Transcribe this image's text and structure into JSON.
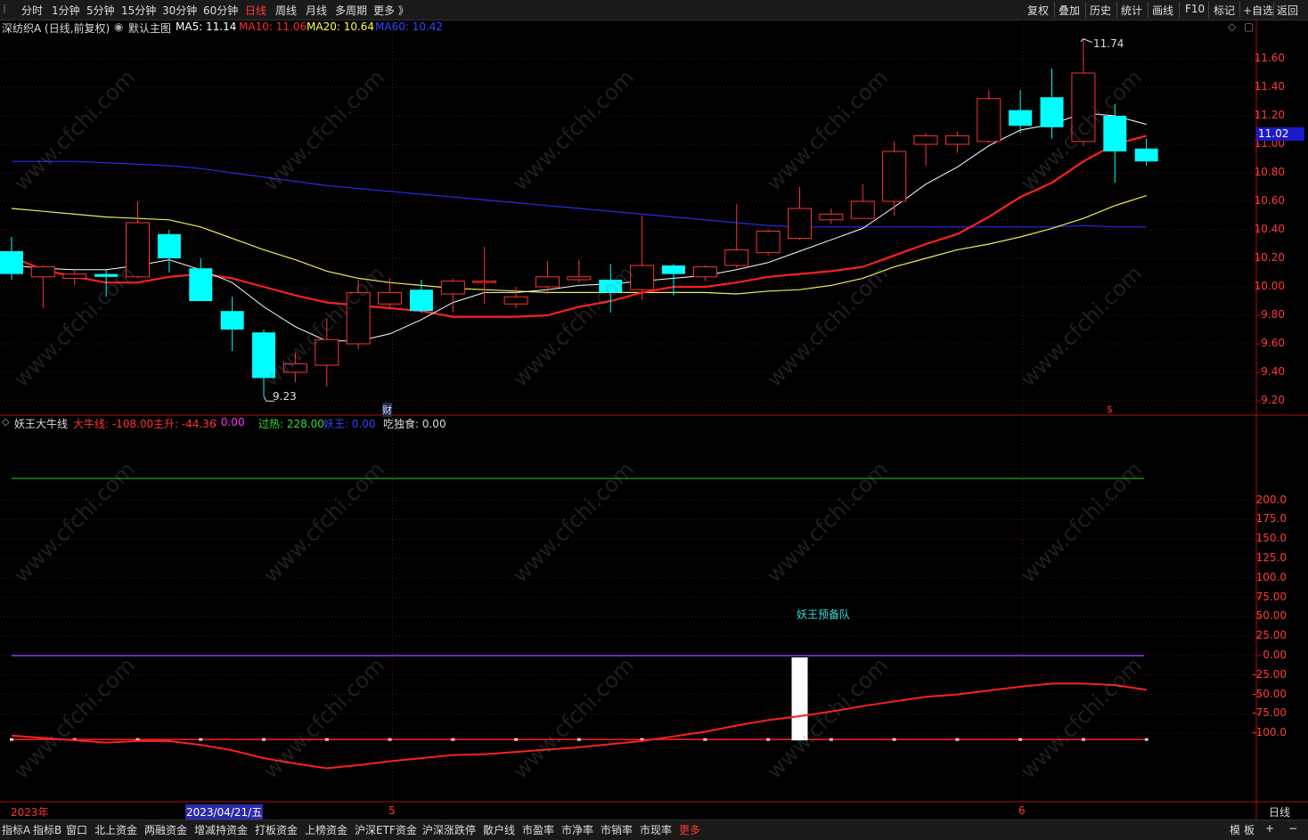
{
  "toolbar": {
    "periods": [
      "分时",
      "1分钟",
      "5分钟",
      "15分钟",
      "30分钟",
      "60分钟",
      "日线",
      "周线",
      "月线",
      "多周期",
      "更多 》"
    ],
    "active_period": "日线",
    "right_buttons": [
      "复权",
      "叠加",
      "历史",
      "统计",
      "画线",
      "F10",
      "标记",
      "+自选",
      "返回"
    ]
  },
  "main_header": {
    "stock": "深纺织A (日线,前复权)",
    "template": "默认主图",
    "ma5_label": "MA5: 11.14",
    "ma10_label": "MA10: 11.06",
    "ma20_label": "MA20: 10.64",
    "ma60_label": "MA60: 10.42",
    "colors": {
      "ma5": "#ffffff",
      "ma10": "#ff2a2a",
      "ma20": "#ffff66",
      "ma60": "#3333ff"
    }
  },
  "price_axis": [
    "11.60",
    "11.40",
    "11.20",
    "11.00",
    "10.80",
    "10.60",
    "10.40",
    "10.20",
    "10.00",
    "9.80",
    "9.60",
    "9.40",
    "9.20"
  ],
  "current_price": "11.02",
  "annotations": {
    "high": "11.74",
    "low": "9.23",
    "cai": "财",
    "s_marker": "$"
  },
  "ind_header": {
    "name": "妖王大牛线",
    "dniu": "大牛线: -108.00",
    "zhusheng": "主升: -44.36",
    "zhusheng_val": ": 0.00",
    "guore": "过热: 228.00",
    "yaowang": "妖王: 0.00",
    "chidushi": "吃独食: 0.00"
  },
  "ind_axis": [
    "200.0",
    "175.0",
    "150.0",
    "125.0",
    "100.0",
    "75.00",
    "50.00",
    "25.00",
    "0.00",
    "-25.00",
    "-50.00",
    "-75.00",
    "-100.0"
  ],
  "ind_text": "妖王预备队",
  "date_axis": {
    "year": "2023年",
    "selected": "2023/04/21/五",
    "m5": "5",
    "m6": "6",
    "period": "日线"
  },
  "bottom_tabs": [
    "指标A",
    "指标B",
    "窗口",
    "北上资金",
    "两融资金",
    "增减持资金",
    "打板资金",
    "上榜资金",
    "沪深ETF资金",
    "沪深涨跌停",
    "散户线",
    "市盈率",
    "市净率",
    "市销率",
    "市现率",
    "更多"
  ],
  "bottom_right": [
    "模",
    "板",
    "+",
    "−"
  ],
  "watermark": "www.cfchi.com",
  "chart_data": {
    "type": "candlestick",
    "candles": [
      {
        "o": 10.25,
        "h": 10.35,
        "l": 10.05,
        "c": 10.09
      },
      {
        "o": 10.07,
        "h": 10.15,
        "l": 9.85,
        "c": 10.14
      },
      {
        "o": 10.06,
        "h": 10.12,
        "l": 10.01,
        "c": 10.09
      },
      {
        "o": 10.09,
        "h": 10.12,
        "l": 9.93,
        "c": 10.07
      },
      {
        "o": 10.07,
        "h": 10.6,
        "l": 10.06,
        "c": 10.45
      },
      {
        "o": 10.37,
        "h": 10.4,
        "l": 10.1,
        "c": 10.2
      },
      {
        "o": 10.13,
        "h": 10.2,
        "l": 9.91,
        "c": 9.9
      },
      {
        "o": 9.83,
        "h": 9.93,
        "l": 9.55,
        "c": 9.7
      },
      {
        "o": 9.68,
        "h": 9.7,
        "l": 9.23,
        "c": 9.36
      },
      {
        "o": 9.4,
        "h": 9.54,
        "l": 9.33,
        "c": 9.46
      },
      {
        "o": 9.45,
        "h": 9.78,
        "l": 9.3,
        "c": 9.63
      },
      {
        "o": 9.6,
        "h": 10.05,
        "l": 9.56,
        "c": 9.96
      },
      {
        "o": 9.88,
        "h": 10.06,
        "l": 9.85,
        "c": 9.96
      },
      {
        "o": 9.98,
        "h": 10.05,
        "l": 9.82,
        "c": 9.83
      },
      {
        "o": 9.95,
        "h": 10.06,
        "l": 9.82,
        "c": 10.04
      },
      {
        "o": 10.03,
        "h": 10.28,
        "l": 9.88,
        "c": 10.04
      },
      {
        "o": 9.88,
        "h": 10.0,
        "l": 9.85,
        "c": 9.93
      },
      {
        "o": 10.0,
        "h": 10.18,
        "l": 9.95,
        "c": 10.07
      },
      {
        "o": 10.05,
        "h": 10.19,
        "l": 10.03,
        "c": 10.07
      },
      {
        "o": 10.05,
        "h": 10.16,
        "l": 9.82,
        "c": 9.96
      },
      {
        "o": 9.98,
        "h": 10.5,
        "l": 9.91,
        "c": 10.15
      },
      {
        "o": 10.15,
        "h": 10.16,
        "l": 9.94,
        "c": 10.09
      },
      {
        "o": 10.07,
        "h": 10.15,
        "l": 10.04,
        "c": 10.14
      },
      {
        "o": 10.15,
        "h": 10.58,
        "l": 10.13,
        "c": 10.26
      },
      {
        "o": 10.24,
        "h": 10.4,
        "l": 10.22,
        "c": 10.39
      },
      {
        "o": 10.34,
        "h": 10.7,
        "l": 10.33,
        "c": 10.55
      },
      {
        "o": 10.47,
        "h": 10.55,
        "l": 10.44,
        "c": 10.51
      },
      {
        "o": 10.48,
        "h": 10.72,
        "l": 10.48,
        "c": 10.6
      },
      {
        "o": 10.6,
        "h": 11.02,
        "l": 10.5,
        "c": 10.95
      },
      {
        "o": 11.0,
        "h": 11.08,
        "l": 10.85,
        "c": 11.06
      },
      {
        "o": 11.0,
        "h": 11.09,
        "l": 10.94,
        "c": 11.06
      },
      {
        "o": 11.02,
        "h": 11.38,
        "l": 11.01,
        "c": 11.32
      },
      {
        "o": 11.24,
        "h": 11.38,
        "l": 11.08,
        "c": 11.13
      },
      {
        "o": 11.33,
        "h": 11.53,
        "l": 11.04,
        "c": 11.12
      },
      {
        "o": 11.02,
        "h": 11.74,
        "l": 10.99,
        "c": 11.5
      },
      {
        "o": 11.2,
        "h": 11.28,
        "l": 10.73,
        "c": 10.95
      },
      {
        "o": 10.97,
        "h": 11.04,
        "l": 10.85,
        "c": 10.88
      }
    ],
    "ma5": [
      10.15,
      10.13,
      10.12,
      10.12,
      10.15,
      10.19,
      10.12,
      10.03,
      9.86,
      9.72,
      9.62,
      9.62,
      9.67,
      9.77,
      9.89,
      9.96,
      9.96,
      9.98,
      10.01,
      10.02,
      10.04,
      10.06,
      10.08,
      10.12,
      10.17,
      10.25,
      10.33,
      10.41,
      10.56,
      10.72,
      10.84,
      10.99,
      11.1,
      11.14,
      11.22,
      11.2,
      11.14
    ],
    "ma10": [
      10.21,
      10.12,
      10.07,
      10.03,
      10.03,
      10.07,
      10.09,
      10.06,
      10.0,
      9.94,
      9.89,
      9.87,
      9.85,
      9.83,
      9.79,
      9.79,
      9.79,
      9.8,
      9.86,
      9.9,
      9.96,
      10.0,
      10.0,
      10.03,
      10.07,
      10.09,
      10.11,
      10.14,
      10.22,
      10.3,
      10.37,
      10.49,
      10.63,
      10.73,
      10.88,
      11.0,
      11.06
    ],
    "ma20": [
      10.55,
      10.53,
      10.51,
      10.49,
      10.48,
      10.47,
      10.42,
      10.34,
      10.26,
      10.19,
      10.11,
      10.06,
      10.03,
      10.01,
      9.99,
      9.98,
      9.97,
      9.96,
      9.96,
      9.96,
      9.96,
      9.96,
      9.96,
      9.95,
      9.97,
      9.98,
      10.01,
      10.06,
      10.14,
      10.2,
      10.26,
      10.3,
      10.35,
      10.41,
      10.48,
      10.57,
      10.64
    ],
    "ma60": [
      10.88,
      10.88,
      10.88,
      10.87,
      10.86,
      10.85,
      10.83,
      10.8,
      10.77,
      10.74,
      10.71,
      10.69,
      10.67,
      10.65,
      10.63,
      10.61,
      10.59,
      10.57,
      10.55,
      10.53,
      10.51,
      10.49,
      10.47,
      10.45,
      10.43,
      10.42,
      10.42,
      10.42,
      10.42,
      10.42,
      10.42,
      10.42,
      10.42,
      10.42,
      10.43,
      10.42,
      10.42
    ],
    "ind_zhusheng": [
      -103,
      -106,
      -109,
      -112,
      -110,
      -110,
      -115,
      -122,
      -132,
      -139,
      -145,
      -141,
      -136,
      -132,
      -128,
      -127,
      -124,
      -121,
      -118,
      -114,
      -110,
      -104,
      -98,
      -90,
      -83,
      -78,
      -72,
      -65,
      -59,
      -53,
      -50,
      -45,
      -40,
      -36,
      -36,
      -38,
      -44
    ],
    "ind_dniu": -108,
    "ind_guore": 228,
    "ind_yaowang_zero": 0,
    "ind_bar_at": 25
  }
}
